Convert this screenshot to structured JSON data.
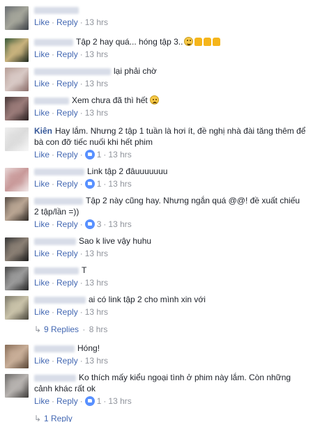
{
  "meta": {
    "like": "Like",
    "reply": "Reply",
    "dot": "·"
  },
  "comments": [
    {
      "name": "",
      "text": "",
      "time": "13 hrs",
      "reactions": "",
      "avatar_colors": [
        "#6b6f73",
        "#a4a59a",
        "#3d4147"
      ]
    },
    {
      "name": "",
      "text": "Tập 2 hay quá... hóng tập 3..",
      "time": "13 hrs",
      "reactions": "",
      "avatar_colors": [
        "#3b5a3a",
        "#c8b27d",
        "#1f2a1e"
      ],
      "emojis": [
        "smile",
        "thumb",
        "thumb",
        "thumb"
      ]
    },
    {
      "name": "",
      "text": "lại phải chờ",
      "time": "13 hrs",
      "reactions": "",
      "avatar_colors": [
        "#b8a099",
        "#d8c9c5",
        "#8c6e6a"
      ]
    },
    {
      "name": "",
      "text": "Xem chưa đã thì hết",
      "time": "13 hrs",
      "reactions": "",
      "avatar_colors": [
        "#4a3a3a",
        "#9a7b79",
        "#2a1f20"
      ],
      "emojis": [
        "sad"
      ]
    },
    {
      "name": "Kiên",
      "text": "Hay lắm. Nhưng 2 tập 1 tuần là hơi ít, đề nghị nhà đài tăng thêm để",
      "text2": "bà con đỡ tiếc nuối khi hết phim",
      "time": "13 hrs",
      "reactions": "1",
      "avatar_colors": [
        "#efefef",
        "#dcdcdc",
        "#f7f7f7"
      ]
    },
    {
      "name": "",
      "text": "Link tập 2 đâuuuuuuu",
      "time": "13 hrs",
      "reactions": "1",
      "avatar_colors": [
        "#e7d6d6",
        "#c99a9a",
        "#f2e9e9"
      ]
    },
    {
      "name": "",
      "text": "Tập 2 này cũng hay. Nhưng ngắn quá @@! đề xuất chiếu",
      "text2": "2 tập/lần =))",
      "time": "13 hrs",
      "reactions": "3",
      "avatar_colors": [
        "#5a5048",
        "#b9a593",
        "#2f2924"
      ]
    },
    {
      "name": "",
      "text": "Sao k live vậy huhu",
      "time": "13 hrs",
      "reactions": "",
      "avatar_colors": [
        "#3a3a3a",
        "#8a7f74",
        "#1c1c1c"
      ]
    },
    {
      "name": "",
      "text": "T",
      "time": "13 hrs",
      "reactions": "",
      "avatar_colors": [
        "#4b4b4b",
        "#9a9a9a",
        "#262626"
      ]
    },
    {
      "name": "",
      "text": "ai có link tập 2 cho mình xin với",
      "time": "13 hrs",
      "reactions": "",
      "avatar_colors": [
        "#7d7a6b",
        "#c9c2a9",
        "#4a473c"
      ]
    },
    {
      "name": "",
      "text": "Hóng!",
      "time": "13 hrs",
      "reactions": "",
      "avatar_colors": [
        "#8a6f5a",
        "#c8ae98",
        "#5a4636"
      ]
    },
    {
      "name": "",
      "text": "Ko thích mấy kiểu ngoại tình ở phim này lắm. Còn những",
      "text2": "cảnh khác rất ok",
      "time": "13 hrs",
      "reactions": "1",
      "avatar_colors": [
        "#6d6b69",
        "#b7b3b0",
        "#3e3c3a"
      ]
    }
  ],
  "replies_a": {
    "label": "9 Replies",
    "time": "8 hrs"
  },
  "replies_b": {
    "label": "1 Reply"
  }
}
